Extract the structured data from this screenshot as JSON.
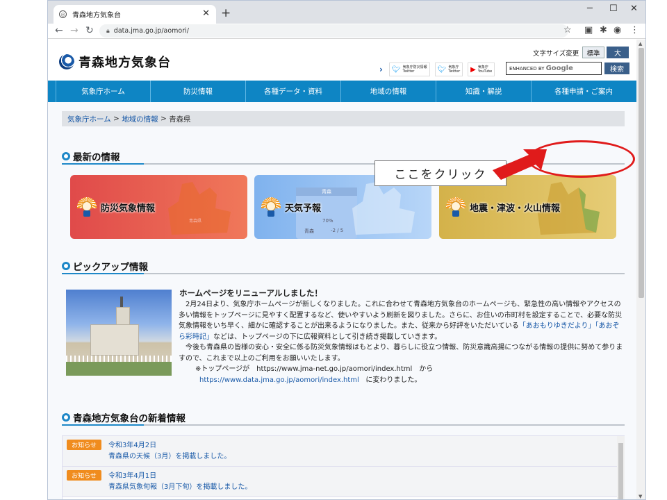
{
  "browser": {
    "tab_title": "青森地方気象台",
    "url": "data.jma.go.jp/aomori/",
    "new_tab": "+",
    "tab_close": "✕",
    "min": "─",
    "max": "☐",
    "close": "✕"
  },
  "header": {
    "site_name": "青森地方気象台",
    "font_size_label": "文字サイズ変更",
    "font_std": "標準",
    "font_big": "大",
    "sns": [
      {
        "line1": "気象庁防災情報",
        "line2": "Twitter"
      },
      {
        "line1": "気象庁",
        "line2": "Twitter"
      },
      {
        "line1": "気象庁",
        "line2": "YouTube"
      }
    ],
    "search_prefix": "ENHANCED BY",
    "search_brand": "Google",
    "search_button": "検索"
  },
  "gnav": [
    "気象庁ホーム",
    "防災情報",
    "各種データ・資料",
    "地域の情報",
    "知識・解説",
    "各種申請・ご案内"
  ],
  "breadcrumb": {
    "home": "気象庁ホーム",
    "region": "地域の情報",
    "current": "青森県",
    "sep": ">"
  },
  "annotation": {
    "callout": "ここをクリック"
  },
  "sections": {
    "latest": "最新の情報",
    "pickup": "ピックアップ情報",
    "news": "青森地方気象台の新着情報"
  },
  "cards": [
    {
      "label": "防災気象情報",
      "bg": "#e04a4a",
      "bg2": "#f0785a"
    },
    {
      "label": "天気予報",
      "bg": "#7fb2ee",
      "bg2": "#b8d6f8"
    },
    {
      "label": "地震・津波・火山情報",
      "bg": "#d4b24a",
      "bg2": "#e6cc76"
    }
  ],
  "card_weather": {
    "pref": "青森",
    "pct": "70%",
    "city": "青森",
    "temp": "-2 / 5"
  },
  "card_map_city": "青森県",
  "pickup": {
    "title": "ホームページをリニューアルしました！",
    "p1": "2月24日より、気象庁ホームページが新しくなりました。これに合わせて青森地方気象台のホームページも、緊急性の高い情報やアクセスの多い情報をトップページに見やすく配置するなど、使いやすいよう刷新を図りました。さらに、お住いの市町村を設定することで、必要な防災気象情報をいち早く、細かに確認することが出来るようになりました。また、従来から好評をいただいている",
    "link1": "「あおもりゆきだより」「あおぞら彩時記」",
    "p1b": "などは、トップページの下に広報資料として引き続き掲載していきます。",
    "p2": "今後も青森県の皆様の安心・安全に係る防災気象情報はもとより、暮らしに役立つ情報、防災意識高揚につながる情報の提供に努めて参りますので、これまで以上のご利用をお願いいたします。",
    "p3a": "※トップページが　https://www.jma-net.go.jp/aomori/index.html　から",
    "p3link": "https://www.data.jma.go.jp/aomori/index.html",
    "p3b": "に変わりました。"
  },
  "news": [
    {
      "badge": "お知らせ",
      "date": "令和3年4月2日",
      "title": "青森県の天候（3月）を掲載しました。"
    },
    {
      "badge": "お知らせ",
      "date": "令和3年4月1日",
      "title": "青森県気象旬報（3月下旬）を掲載しました。"
    }
  ]
}
